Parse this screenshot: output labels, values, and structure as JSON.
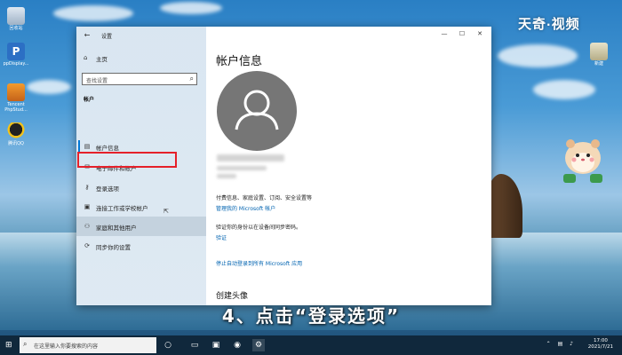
{
  "watermark": {
    "brand_a": "天奇",
    "dot": "·",
    "brand_b": "视频"
  },
  "caption": "4、点击“登录选项”",
  "desktop_icons": [
    {
      "label": "回收站"
    },
    {
      "label": "ppDisplay..."
    },
    {
      "label": "Tencent PhpStud..."
    },
    {
      "label": "腾讯QQ"
    }
  ],
  "right_icon": {
    "label": "新建"
  },
  "window": {
    "title": "设置",
    "controls": {
      "minimize": "—",
      "maximize": "☐",
      "close": "✕"
    },
    "sidebar": {
      "home_label": "主页",
      "search_placeholder": "查找设置",
      "section_label": "帐户",
      "items": [
        {
          "label": "帐户信息",
          "icon": "person-card-icon"
        },
        {
          "label": "电子邮件和帐户",
          "icon": "mail-icon"
        },
        {
          "label": "登录选项",
          "icon": "key-icon"
        },
        {
          "label": "连接工作或学校帐户",
          "icon": "briefcase-icon"
        },
        {
          "label": "家庭和其他用户",
          "icon": "people-icon"
        },
        {
          "label": "同步你的设置",
          "icon": "sync-icon"
        }
      ]
    },
    "content": {
      "page_title": "帐户信息",
      "info_line_1": "付费信息、家庭设置、订阅、安全设置等",
      "link_manage": "管理我的 Microsoft 帐户",
      "info_line_2": "验证你的身份以在设备间同步密码。",
      "link_verify": "验证",
      "link_stop": "停止自动登录到所有 Microsoft 应用",
      "sub_title": "创建头像"
    }
  },
  "taskbar": {
    "search_placeholder": "在这里输入你要搜索的内容",
    "time": "17:00",
    "date": "2021/7/21"
  },
  "colors": {
    "accent": "#0078d7",
    "link": "#0063b1",
    "highlight": "#e5202a",
    "taskbar": "#10283c"
  }
}
